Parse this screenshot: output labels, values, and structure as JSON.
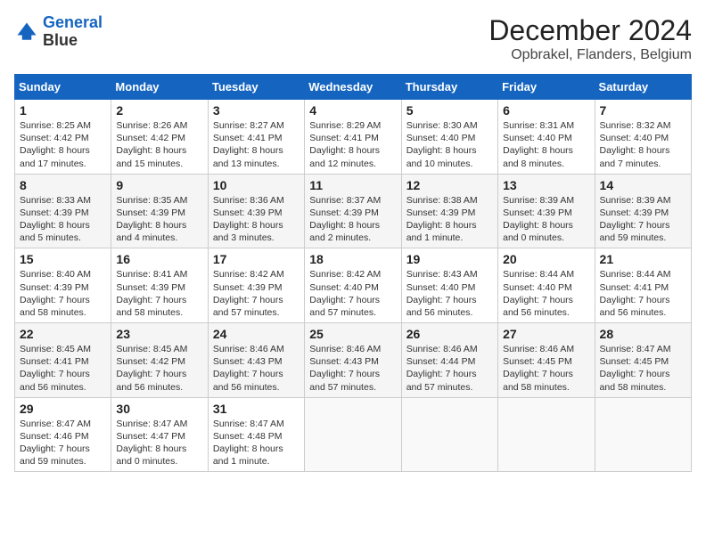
{
  "header": {
    "logo_line1": "General",
    "logo_line2": "Blue",
    "main_title": "December 2024",
    "subtitle": "Opbrakel, Flanders, Belgium"
  },
  "calendar": {
    "columns": [
      "Sunday",
      "Monday",
      "Tuesday",
      "Wednesday",
      "Thursday",
      "Friday",
      "Saturday"
    ],
    "weeks": [
      [
        {
          "day": "1",
          "info": "Sunrise: 8:25 AM\nSunset: 4:42 PM\nDaylight: 8 hours and 17 minutes."
        },
        {
          "day": "2",
          "info": "Sunrise: 8:26 AM\nSunset: 4:42 PM\nDaylight: 8 hours and 15 minutes."
        },
        {
          "day": "3",
          "info": "Sunrise: 8:27 AM\nSunset: 4:41 PM\nDaylight: 8 hours and 13 minutes."
        },
        {
          "day": "4",
          "info": "Sunrise: 8:29 AM\nSunset: 4:41 PM\nDaylight: 8 hours and 12 minutes."
        },
        {
          "day": "5",
          "info": "Sunrise: 8:30 AM\nSunset: 4:40 PM\nDaylight: 8 hours and 10 minutes."
        },
        {
          "day": "6",
          "info": "Sunrise: 8:31 AM\nSunset: 4:40 PM\nDaylight: 8 hours and 8 minutes."
        },
        {
          "day": "7",
          "info": "Sunrise: 8:32 AM\nSunset: 4:40 PM\nDaylight: 8 hours and 7 minutes."
        }
      ],
      [
        {
          "day": "8",
          "info": "Sunrise: 8:33 AM\nSunset: 4:39 PM\nDaylight: 8 hours and 5 minutes."
        },
        {
          "day": "9",
          "info": "Sunrise: 8:35 AM\nSunset: 4:39 PM\nDaylight: 8 hours and 4 minutes."
        },
        {
          "day": "10",
          "info": "Sunrise: 8:36 AM\nSunset: 4:39 PM\nDaylight: 8 hours and 3 minutes."
        },
        {
          "day": "11",
          "info": "Sunrise: 8:37 AM\nSunset: 4:39 PM\nDaylight: 8 hours and 2 minutes."
        },
        {
          "day": "12",
          "info": "Sunrise: 8:38 AM\nSunset: 4:39 PM\nDaylight: 8 hours and 1 minute."
        },
        {
          "day": "13",
          "info": "Sunrise: 8:39 AM\nSunset: 4:39 PM\nDaylight: 8 hours and 0 minutes."
        },
        {
          "day": "14",
          "info": "Sunrise: 8:39 AM\nSunset: 4:39 PM\nDaylight: 7 hours and 59 minutes."
        }
      ],
      [
        {
          "day": "15",
          "info": "Sunrise: 8:40 AM\nSunset: 4:39 PM\nDaylight: 7 hours and 58 minutes."
        },
        {
          "day": "16",
          "info": "Sunrise: 8:41 AM\nSunset: 4:39 PM\nDaylight: 7 hours and 58 minutes."
        },
        {
          "day": "17",
          "info": "Sunrise: 8:42 AM\nSunset: 4:39 PM\nDaylight: 7 hours and 57 minutes."
        },
        {
          "day": "18",
          "info": "Sunrise: 8:42 AM\nSunset: 4:40 PM\nDaylight: 7 hours and 57 minutes."
        },
        {
          "day": "19",
          "info": "Sunrise: 8:43 AM\nSunset: 4:40 PM\nDaylight: 7 hours and 56 minutes."
        },
        {
          "day": "20",
          "info": "Sunrise: 8:44 AM\nSunset: 4:40 PM\nDaylight: 7 hours and 56 minutes."
        },
        {
          "day": "21",
          "info": "Sunrise: 8:44 AM\nSunset: 4:41 PM\nDaylight: 7 hours and 56 minutes."
        }
      ],
      [
        {
          "day": "22",
          "info": "Sunrise: 8:45 AM\nSunset: 4:41 PM\nDaylight: 7 hours and 56 minutes."
        },
        {
          "day": "23",
          "info": "Sunrise: 8:45 AM\nSunset: 4:42 PM\nDaylight: 7 hours and 56 minutes."
        },
        {
          "day": "24",
          "info": "Sunrise: 8:46 AM\nSunset: 4:43 PM\nDaylight: 7 hours and 56 minutes."
        },
        {
          "day": "25",
          "info": "Sunrise: 8:46 AM\nSunset: 4:43 PM\nDaylight: 7 hours and 57 minutes."
        },
        {
          "day": "26",
          "info": "Sunrise: 8:46 AM\nSunset: 4:44 PM\nDaylight: 7 hours and 57 minutes."
        },
        {
          "day": "27",
          "info": "Sunrise: 8:46 AM\nSunset: 4:45 PM\nDaylight: 7 hours and 58 minutes."
        },
        {
          "day": "28",
          "info": "Sunrise: 8:47 AM\nSunset: 4:45 PM\nDaylight: 7 hours and 58 minutes."
        }
      ],
      [
        {
          "day": "29",
          "info": "Sunrise: 8:47 AM\nSunset: 4:46 PM\nDaylight: 7 hours and 59 minutes."
        },
        {
          "day": "30",
          "info": "Sunrise: 8:47 AM\nSunset: 4:47 PM\nDaylight: 8 hours and 0 minutes."
        },
        {
          "day": "31",
          "info": "Sunrise: 8:47 AM\nSunset: 4:48 PM\nDaylight: 8 hours and 1 minute."
        },
        {
          "day": "",
          "info": ""
        },
        {
          "day": "",
          "info": ""
        },
        {
          "day": "",
          "info": ""
        },
        {
          "day": "",
          "info": ""
        }
      ]
    ]
  }
}
